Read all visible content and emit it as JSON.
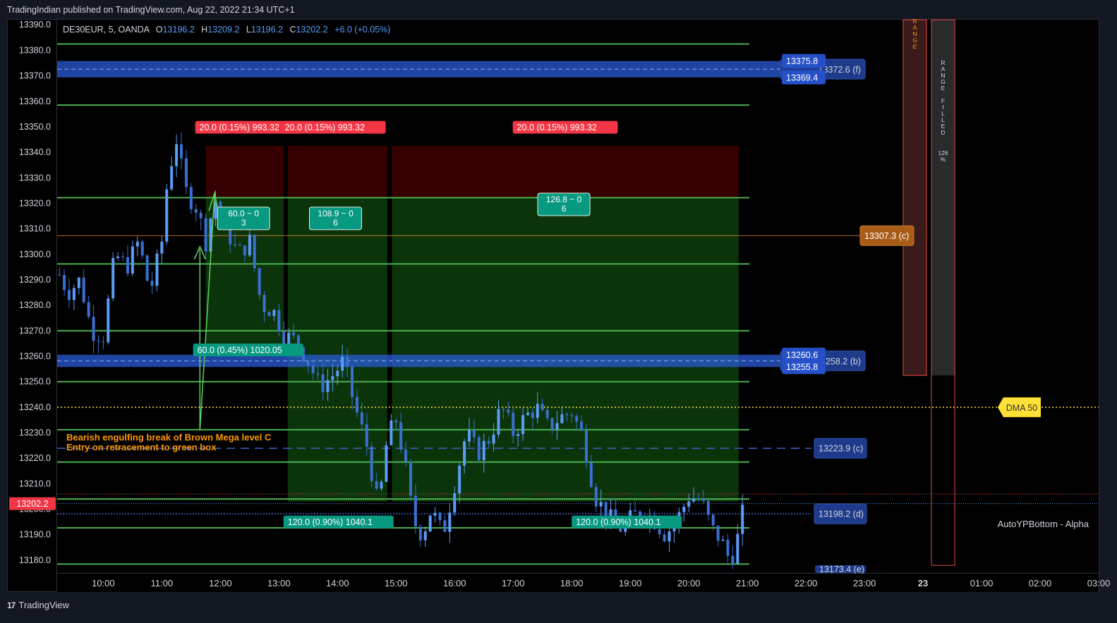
{
  "header": {
    "publisher_text": "TradingIndian published on TradingView.com, Aug 22, 2022 21:34 UTC+1"
  },
  "legend": {
    "symbol": "DE30EUR, 5, OANDA",
    "o_label": "O",
    "o_value": "13196.2",
    "h_label": "H",
    "h_value": "13209.2",
    "l_label": "L",
    "l_value": "13196.2",
    "c_label": "C",
    "c_value": "13202.2",
    "change": "+6.0 (+0.05%)"
  },
  "footer": {
    "logo_glyph": "17",
    "brand": "TradingView"
  },
  "colors": {
    "bullish": "#5b9cf6",
    "bearish": "#3a6fd0",
    "green_level": "#4caf50",
    "blue_zone": "#2a5bd7",
    "brown": "#e0852d",
    "yellow": "#ffe135",
    "stop_zone": "#3a0000",
    "target_zone": "#0c3a0c"
  },
  "chart_data": {
    "type": "candlestick",
    "symbol": "DE30EUR",
    "timeframe": "5",
    "ylim": [
      13175,
      13392
    ],
    "y_ticks": [
      13180,
      13190,
      13200,
      13210,
      13220,
      13230,
      13240,
      13250,
      13260,
      13270,
      13280,
      13290,
      13300,
      13310,
      13320,
      13330,
      13340,
      13350,
      13360,
      13370,
      13380,
      13390
    ],
    "y_tick_labels": [
      "13180.0",
      "13190.0",
      "13200.0",
      "13210.0",
      "13220.0",
      "13230.0",
      "13240.0",
      "13250.0",
      "13260.0",
      "13270.0",
      "13280.0",
      "13290.0",
      "13300.0",
      "13310.0",
      "13320.0",
      "13330.0",
      "13340.0",
      "13350.0",
      "13360.0",
      "13370.0",
      "13380.0",
      "13390.0"
    ],
    "xlim_hours": [
      9.2,
      27.0
    ],
    "x_ticks": [
      {
        "h": 10,
        "label": "10:00"
      },
      {
        "h": 11,
        "label": "11:00"
      },
      {
        "h": 12,
        "label": "12:00"
      },
      {
        "h": 13,
        "label": "13:00"
      },
      {
        "h": 14,
        "label": "14:00"
      },
      {
        "h": 15,
        "label": "15:00"
      },
      {
        "h": 16,
        "label": "16:00"
      },
      {
        "h": 17,
        "label": "17:00"
      },
      {
        "h": 18,
        "label": "18:00"
      },
      {
        "h": 19,
        "label": "19:00"
      },
      {
        "h": 20,
        "label": "20:00"
      },
      {
        "h": 21,
        "label": "21:00"
      },
      {
        "h": 22,
        "label": "22:00"
      },
      {
        "h": 23,
        "label": "23:00"
      },
      {
        "h": 24,
        "label": "23"
      },
      {
        "h": 25,
        "label": "01:00"
      },
      {
        "h": 26,
        "label": "02:00"
      },
      {
        "h": 27,
        "label": "03:00"
      }
    ],
    "price_path": [
      [
        9.25,
        13292
      ],
      [
        9.4,
        13285
      ],
      [
        9.6,
        13290
      ],
      [
        9.8,
        13270
      ],
      [
        10.0,
        13268
      ],
      [
        10.2,
        13300
      ],
      [
        10.4,
        13295
      ],
      [
        10.6,
        13305
      ],
      [
        10.8,
        13285
      ],
      [
        11.0,
        13305
      ],
      [
        11.1,
        13330
      ],
      [
        11.25,
        13345
      ],
      [
        11.4,
        13325
      ],
      [
        11.6,
        13318
      ],
      [
        11.75,
        13305
      ],
      [
        11.9,
        13322
      ],
      [
        12.1,
        13310
      ],
      [
        12.3,
        13300
      ],
      [
        12.5,
        13305
      ],
      [
        12.7,
        13280
      ],
      [
        12.9,
        13278
      ],
      [
        13.1,
        13268
      ],
      [
        13.3,
        13266
      ],
      [
        13.5,
        13258
      ],
      [
        13.7,
        13248
      ],
      [
        13.9,
        13252
      ],
      [
        14.1,
        13258
      ],
      [
        14.3,
        13240
      ],
      [
        14.5,
        13225
      ],
      [
        14.7,
        13200
      ],
      [
        14.85,
        13228
      ],
      [
        15.0,
        13235
      ],
      [
        15.15,
        13218
      ],
      [
        15.3,
        13195
      ],
      [
        15.45,
        13190
      ],
      [
        15.6,
        13200
      ],
      [
        15.8,
        13190
      ],
      [
        16.0,
        13210
      ],
      [
        16.2,
        13230
      ],
      [
        16.4,
        13222
      ],
      [
        16.6,
        13228
      ],
      [
        16.8,
        13240
      ],
      [
        17.0,
        13230
      ],
      [
        17.2,
        13236
      ],
      [
        17.4,
        13240
      ],
      [
        17.6,
        13232
      ],
      [
        17.8,
        13236
      ],
      [
        18.0,
        13238
      ],
      [
        18.2,
        13228
      ],
      [
        18.4,
        13205
      ],
      [
        18.6,
        13198
      ],
      [
        18.8,
        13192
      ],
      [
        19.0,
        13196
      ],
      [
        19.2,
        13200
      ],
      [
        19.4,
        13196
      ],
      [
        19.6,
        13190
      ],
      [
        19.8,
        13196
      ],
      [
        20.0,
        13205
      ],
      [
        20.2,
        13204
      ],
      [
        20.4,
        13192
      ],
      [
        20.55,
        13188
      ],
      [
        20.7,
        13180
      ],
      [
        20.8,
        13185
      ],
      [
        20.9,
        13196
      ],
      [
        20.95,
        13202
      ]
    ],
    "green_levels": [
      13382.5,
      13358.5,
      13322.2,
      13296.2,
      13270,
      13250,
      13231.2,
      13218.5,
      13204,
      13192.7,
      13178.5
    ],
    "blue_zones": [
      {
        "top": 13375.8,
        "bottom": 13369.4,
        "mid": 13372.6,
        "top_label": "13375.8",
        "bottom_label": "13369.4",
        "mid_label": "13372.6 (f)"
      },
      {
        "top": 13260.6,
        "bottom": 13255.8,
        "mid": 13258.2,
        "top_label": "13260.6",
        "bottom_label": "13255.8",
        "mid_label": "13258.2 (b)"
      }
    ],
    "brown_level": {
      "price": 13307.3,
      "label": "13307.3 (c)"
    },
    "dashed_levels": [
      {
        "price": 13223.9,
        "label": "13223.9 (c)"
      },
      {
        "price": 13198.2,
        "label": "13198.2 (d)"
      },
      {
        "price": 13175.4,
        "label": "13173.4 (e)"
      }
    ],
    "dma": {
      "price": 13240,
      "label": "DMA 50"
    },
    "current_price": {
      "price": 13202.2,
      "label": "13202.2"
    },
    "red_dotted_price": 13206,
    "positions": [
      {
        "x1": 11.75,
        "x2": 13.08,
        "entry": 13322.2,
        "stop": 13342.5,
        "target": 13262.5,
        "stop_label": "20.0 (0.15%) 993.32",
        "target_label": "60.0 (0.45%) 1020.05",
        "stats": [
          "60.0 ~ 0",
          "3"
        ]
      },
      {
        "x1": 13.15,
        "x2": 14.85,
        "entry": 13322.2,
        "stop": 13342.5,
        "target": 13203,
        "stop_label": "20.0 (0.15%) 993.32",
        "target_label": "120.0 (0.90%) 1040.1",
        "stats": [
          "108.9 ~ 0",
          "6"
        ]
      },
      {
        "x1": 14.93,
        "x2": 20.85,
        "entry": 13322.2,
        "stop": 13342.5,
        "target": 13203,
        "stop_label": "20.0 (0.15%) 993.32",
        "target_label": "120.0 (0.90%) 1040.1",
        "stats": [
          "126.8 ~ 0",
          "6"
        ]
      }
    ],
    "annotation": {
      "lines": [
        "Bearish engulfing break of Brown Mega level C",
        "Entry on retracement to green box"
      ]
    },
    "range_panel": {
      "text": "RANGE",
      "x1": 24.27,
      "x2": 24.67,
      "top": 13392,
      "bottom": 13252.5
    },
    "range_filled_panel": {
      "text": "RANGE FILLED",
      "percent": "126 %",
      "x1": 24.77,
      "x2": 25.17,
      "top": 13392,
      "bottom": 13178
    },
    "indicator_name": "AutoYPBottom - Alpha"
  }
}
